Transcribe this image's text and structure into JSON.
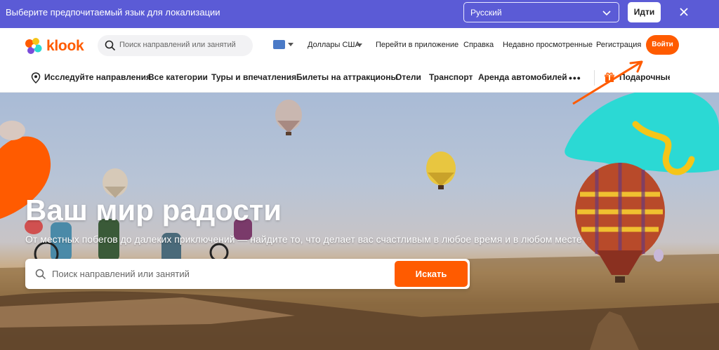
{
  "lang_bar": {
    "prompt": "Выберите предпочитаемый язык для локализации",
    "selected_language": "Русский",
    "go_label": "Идти"
  },
  "header": {
    "logo_text": "klook",
    "search_placeholder": "Поиск направлений или занятий",
    "currency": "Доллары США",
    "links": [
      "Перейти в приложение",
      "Справка",
      "Недавно просмотренные",
      "Регистрация"
    ],
    "login_label": "Войти"
  },
  "categories": {
    "items": [
      "Исследуйте направления",
      "Все категории",
      "Туры и впечатления",
      "Билеты на аттракционы",
      "Отели",
      "Транспорт",
      "Аренда автомобилей"
    ],
    "more": "•••",
    "gift_label": "Подарочные карты"
  },
  "hero": {
    "title": "Ваш мир радости",
    "subtitle": "От местных побегов до далеких приключений — найдите то, что делает вас счастливым в любое время и в любом месте",
    "search_placeholder": "Поиск направлений или занятий",
    "search_button": "Искать"
  },
  "colors": {
    "lang_bar": "#5b5bd6",
    "brand_orange": "#ff5b00",
    "teal_accent": "#2bd9d4",
    "yellow_accent": "#f5c518"
  }
}
